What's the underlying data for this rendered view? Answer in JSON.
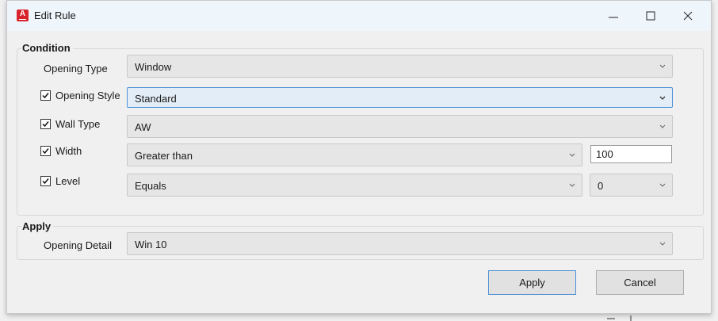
{
  "window": {
    "title": "Edit Rule",
    "app_icon_letter": "A",
    "controls": [
      "minimize-icon",
      "maximize-icon",
      "close-icon"
    ]
  },
  "condition": {
    "legend": "Condition",
    "opening_type": {
      "label": "Opening Type",
      "value": "Window"
    },
    "opening_style": {
      "label": "Opening Style",
      "checked": true,
      "value": "Standard"
    },
    "wall_type": {
      "label": "Wall Type",
      "checked": true,
      "value": "AW"
    },
    "width": {
      "label": "Width",
      "checked": true,
      "operator": "Greater than",
      "value": "100"
    },
    "level": {
      "label": "Level",
      "checked": true,
      "operator": "Equals",
      "value": "0"
    }
  },
  "apply": {
    "legend": "Apply",
    "opening_detail": {
      "label": "Opening Detail",
      "value": "Win 10"
    }
  },
  "buttons": {
    "apply": "Apply",
    "cancel": "Cancel"
  },
  "colors": {
    "accent": "#4c8fd6",
    "app_icon": "#d8232a",
    "titlebar": "#eef5fb"
  }
}
